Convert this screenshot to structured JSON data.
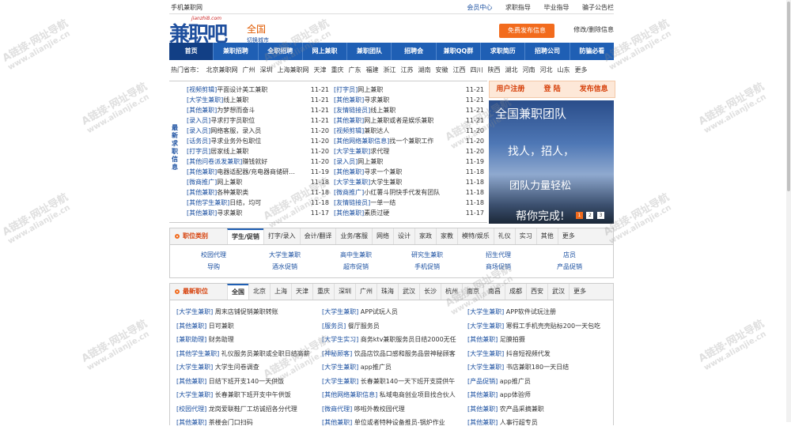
{
  "topbar": {
    "mobile": "手机兼职网",
    "links": [
      "会员中心",
      "求职指导",
      "毕业指导",
      "骗子公告栏"
    ]
  },
  "header": {
    "logo_text": "兼职吧",
    "domain": "jianzhi8.com",
    "city": "全国",
    "switch_city": "切换城市",
    "publish_button": "免费发布信息",
    "edit_link": "修改/删除信息"
  },
  "nav": [
    "首页",
    "兼职招聘",
    "全职招聘",
    "网上兼职",
    "兼职团队",
    "招聘会",
    "兼职QQ群",
    "求职简历",
    "招聘公司",
    "防骗必看"
  ],
  "hot_cities": {
    "label": "热门省市：",
    "items": [
      "北京兼职网",
      "广州",
      "深圳",
      "上海兼职网",
      "天津",
      "重庆",
      "广东",
      "福建",
      "浙江",
      "江苏",
      "湖南",
      "安徽",
      "江西",
      "四川",
      "陕西",
      "湖北",
      "河南",
      "河北",
      "山东",
      "更多"
    ]
  },
  "latest": {
    "vertical_label": "最新求职信息",
    "left": [
      {
        "cat": "[视频剪辑]",
        "title": "平面设计美工兼职",
        "date": "11-21"
      },
      {
        "cat": "[大学生兼职]",
        "title": "线上兼职",
        "date": "11-21"
      },
      {
        "cat": "[其他兼职]",
        "title": "为梦想而奋斗",
        "date": "11-21"
      },
      {
        "cat": "[录入员]",
        "title": "寻求打字员职位",
        "date": "11-21"
      },
      {
        "cat": "[录入员]",
        "title": "网络客服，录入员",
        "date": "11-20"
      },
      {
        "cat": "[话务员]",
        "title": "寻求业务外包职位",
        "date": "11-20"
      },
      {
        "cat": "[打字员]",
        "title": "居家线上兼职",
        "date": "11-20"
      },
      {
        "cat": "[其他问卷派发兼职]",
        "title": "赚钱就好",
        "date": "11-20"
      },
      {
        "cat": "[其他兼职]",
        "title": "电器适配器/充电器商储研…",
        "date": "11-19"
      },
      {
        "cat": "[微商推广]",
        "title": "网上兼职",
        "date": "11-18"
      },
      {
        "cat": "[其他兼职]",
        "title": "各种兼职类",
        "date": "11-18"
      },
      {
        "cat": "[其他学生兼职]",
        "title": "日结，均可",
        "date": "11-18"
      },
      {
        "cat": "[其他兼职]",
        "title": "寻求兼职",
        "date": "11-17"
      }
    ],
    "right": [
      {
        "cat": "[打字员]",
        "title": "网上兼职",
        "date": "11-21"
      },
      {
        "cat": "[其他兼职]",
        "title": "寻求兼职",
        "date": "11-21"
      },
      {
        "cat": "[友情链接员]",
        "title": "线上兼职",
        "date": "11-21"
      },
      {
        "cat": "[其他兼职]",
        "title": "网上兼职或者是娱乐兼职",
        "date": "11-21"
      },
      {
        "cat": "[视频剪辑]",
        "title": "兼职达人",
        "date": "11-20"
      },
      {
        "cat": "[其他网络兼职信息]",
        "title": "找一个兼职工作",
        "date": "11-20"
      },
      {
        "cat": "[大学生兼职]",
        "title": "求代理",
        "date": "11-20"
      },
      {
        "cat": "[录入员]",
        "title": "网上兼职",
        "date": "11-19"
      },
      {
        "cat": "[其他兼职]",
        "title": "寻求一个兼职",
        "date": "11-18"
      },
      {
        "cat": "[大学生兼职]",
        "title": "大学生兼职",
        "date": "11-18"
      },
      {
        "cat": "[微商推广]",
        "title": "小红薯斗阴快手代发有团队",
        "date": "11-18"
      },
      {
        "cat": "[友情链接员]",
        "title": "一单一结",
        "date": "11-18"
      },
      {
        "cat": "[其他兼职]",
        "title": "素质过硬",
        "date": "11-17"
      }
    ]
  },
  "side": {
    "register": "用户注册",
    "login": "登 陆",
    "publish": "发布信息",
    "banner_lines": [
      "全国兼职团队",
      "找人，招人，",
      "团队力量轻松",
      "帮你完成!"
    ],
    "pages": [
      "1",
      "2",
      "3"
    ]
  },
  "categories": {
    "title": "职位类别",
    "tabs": [
      "学生/促销",
      "打字/录入",
      "会计/翻译",
      "业务/客服",
      "网络",
      "设计",
      "家政",
      "家教",
      "模特/娱乐",
      "礼仪",
      "实习",
      "其他",
      "更多"
    ],
    "items": [
      "校园代理",
      "大学生兼职",
      "高中生兼职",
      "研究生兼职",
      "招生代理",
      "店员",
      "导购",
      "酒水促销",
      "超市促销",
      "手机促销",
      "商场促销",
      "产品促销"
    ]
  },
  "jobs": {
    "title": "最新职位",
    "tabs": [
      "全国",
      "北京",
      "上海",
      "天津",
      "重庆",
      "深圳",
      "广州",
      "珠海",
      "武汉",
      "长沙",
      "杭州",
      "南京",
      "南昌",
      "成都",
      "西安",
      "武汉",
      "更多"
    ],
    "items": [
      {
        "cat": "[大学生兼职]",
        "title": "周末店铺促销兼职转账"
      },
      {
        "cat": "[大学生兼职]",
        "title": "APP试玩人员"
      },
      {
        "cat": "[大学生兼职]",
        "title": "APP软件试玩注册"
      },
      {
        "cat": "[其他兼职]",
        "title": "日可兼职"
      },
      {
        "cat": "[服务员]",
        "title": "餐厅服务员"
      },
      {
        "cat": "[大学生兼职]",
        "title": "寒假工手机壳壳贴标200一天包吃"
      },
      {
        "cat": "[兼职助理]",
        "title": "财务助理"
      },
      {
        "cat": "[大学生实习]",
        "title": "商务ktv兼职服务员日结2000无任"
      },
      {
        "cat": "[其他兼职]",
        "title": "足膜拍摄"
      },
      {
        "cat": "[其他学生兼职]",
        "title": "礼仪服务员兼职或全职日结高薪"
      },
      {
        "cat": "[神秘顾客]",
        "title": "饮品店饮品口感和服务品尝神秘顾客"
      },
      {
        "cat": "[大学生兼职]",
        "title": "抖音短视频代发"
      },
      {
        "cat": "[大学生兼职]",
        "title": "大学生问卷调查"
      },
      {
        "cat": "[大学生兼职]",
        "title": "app推广员"
      },
      {
        "cat": "[大学生兼职]",
        "title": "书店兼职180一天日结"
      },
      {
        "cat": "[其他兼职]",
        "title": "日结下班开支140一天供饭"
      },
      {
        "cat": "[大学生兼职]",
        "title": "长春兼职140一天下班开支提供午"
      },
      {
        "cat": "[产品促销]",
        "title": "app推广员"
      },
      {
        "cat": "[大学生兼职]",
        "title": "长春兼职下班开支中午供饭"
      },
      {
        "cat": "[其他网络兼职信息]",
        "title": "私域电商创业项目找合伙人"
      },
      {
        "cat": "[其他兼职]",
        "title": "app体验师"
      },
      {
        "cat": "[校园代理]",
        "title": "龙岗爱联鞋厂工坊诚招各分代理"
      },
      {
        "cat": "[微商代理]",
        "title": "哆啦外教校园代理"
      },
      {
        "cat": "[其他兼职]",
        "title": "农产品采摘兼职"
      },
      {
        "cat": "[其他兼职]",
        "title": "茶楼会门口扫码"
      },
      {
        "cat": "[其他兼职]",
        "title": "单位或者特种设备推员-锅炉作业"
      },
      {
        "cat": "[其他兼职]",
        "title": "人事行超专员"
      }
    ]
  },
  "watermark": {
    "brand": "A链接·网址导航",
    "url": "www.alianjie.cn"
  }
}
